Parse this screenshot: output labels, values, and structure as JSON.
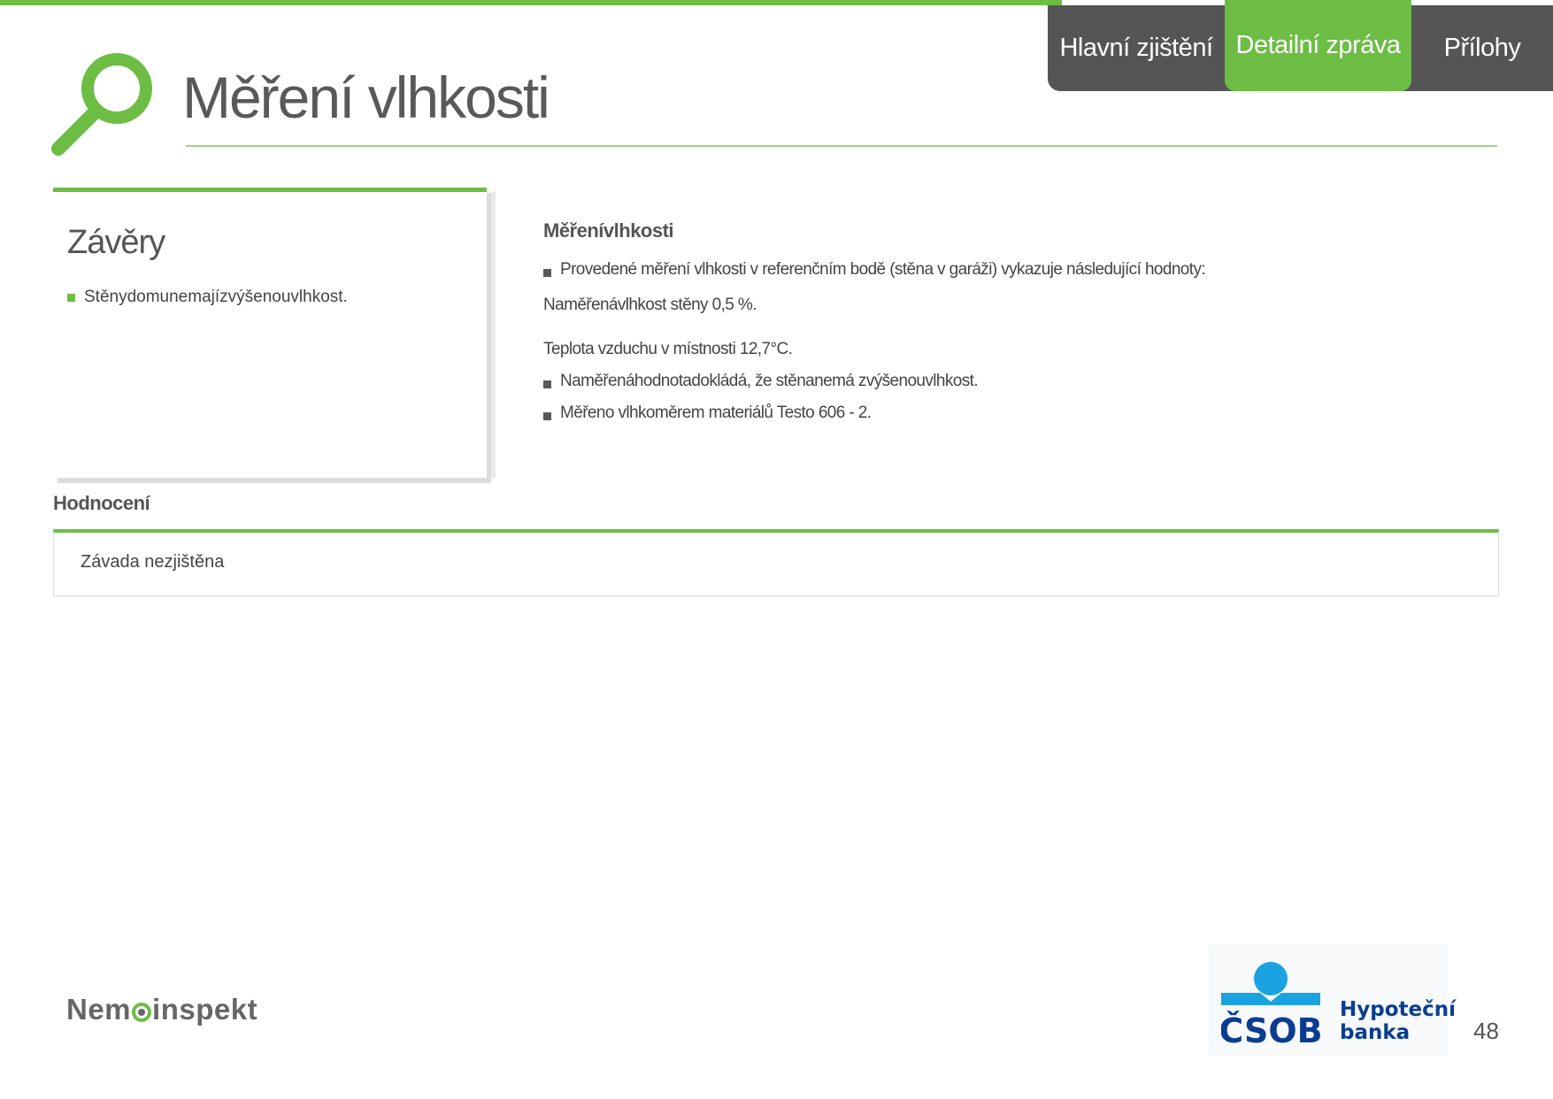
{
  "tabs": [
    {
      "label": "Hlavní zjištění",
      "active": false
    },
    {
      "label": "Detailní zpráva",
      "active": true
    },
    {
      "label": "Přílohy",
      "active": false
    }
  ],
  "header": {
    "title": "Měření vlhkosti",
    "icon": "magnifier-icon"
  },
  "conclusions": {
    "title": "Závěry",
    "items": [
      "Stěnydomunemajízvýšenouvlhkost."
    ]
  },
  "detail": {
    "heading": "Měřenívlhkosti",
    "lines": [
      "Provedené měření vlhkosti v referenčním bodě (stěna v garáži) vykazuje následující hodnoty:",
      "Naměřenávlhkost stěny 0,5 %.",
      "Teplota vzduchu v místnosti 12,7°C.",
      "Naměřenáhodnotadokládá, že stěnanemá zvýšenouvlhkost.",
      "Měřeno vlhkoměrem materiálů Testo 606 - 2."
    ]
  },
  "rating": {
    "label": "Hodnocení",
    "value": "Závada nezjištěna"
  },
  "footer": {
    "logo_left": "Nemoinspekt",
    "logo_left_parts": [
      "Nem",
      "inspekt"
    ],
    "bank_mark": "ČSOB",
    "bank_name_line1": "Hypoteční",
    "bank_name_line2": "banka",
    "page_number": "48"
  },
  "colors": {
    "accent": "#6dbd45",
    "tab_bg": "#555555",
    "text": "#555555",
    "bank_blue": "#0a3d8f",
    "bank_cyan": "#1aa3e0"
  }
}
